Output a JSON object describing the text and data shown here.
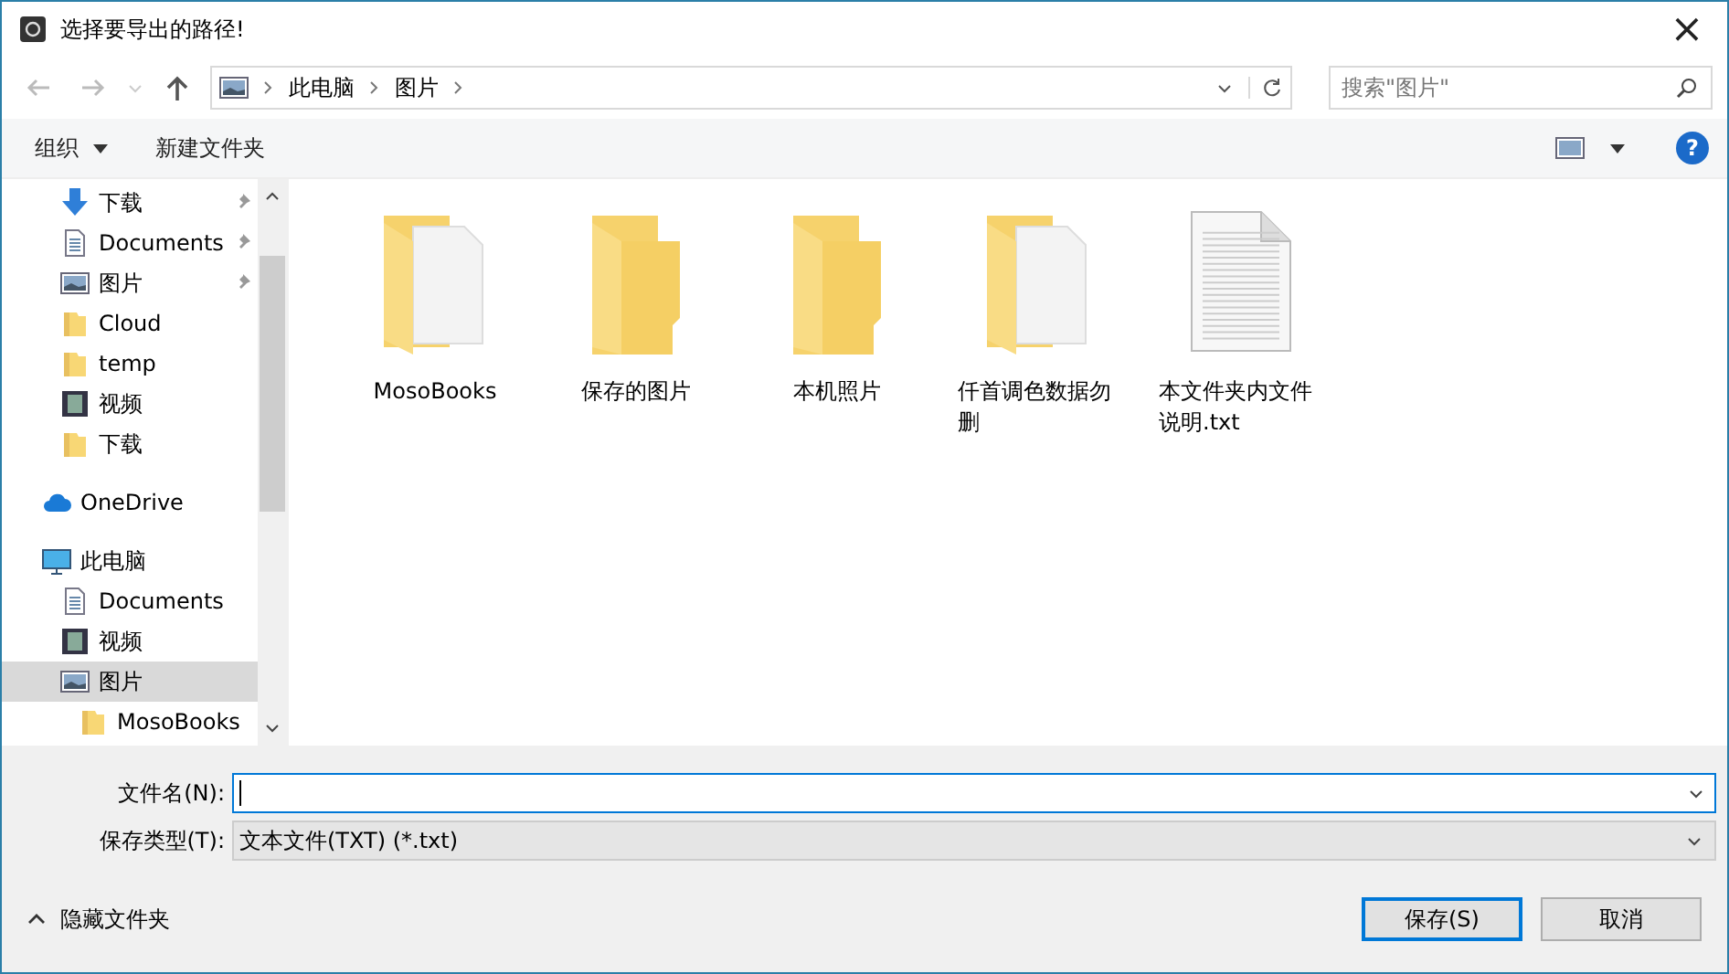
{
  "window": {
    "title": "选择要导出的路径!",
    "close": "×"
  },
  "address": {
    "crumbs": [
      "此电脑",
      "图片"
    ]
  },
  "search": {
    "placeholder": "搜索\"图片\""
  },
  "toolbar": {
    "organize": "组织",
    "new_folder": "新建文件夹",
    "help": "?"
  },
  "sidebar": {
    "items": [
      {
        "label": "下载",
        "kind": "download",
        "pinned": true,
        "selected": false
      },
      {
        "label": "Documents",
        "kind": "document",
        "pinned": true,
        "selected": false
      },
      {
        "label": "图片",
        "kind": "picture",
        "pinned": true,
        "selected": false
      },
      {
        "label": "Cloud",
        "kind": "folder",
        "pinned": false,
        "selected": false
      },
      {
        "label": "temp",
        "kind": "folder",
        "pinned": false,
        "selected": false
      },
      {
        "label": "视频",
        "kind": "video",
        "pinned": false,
        "selected": false
      },
      {
        "label": "下载",
        "kind": "folder",
        "pinned": false,
        "selected": false
      },
      {
        "label": "OneDrive",
        "kind": "cloud",
        "pinned": false,
        "selected": false
      },
      {
        "label": "此电脑",
        "kind": "pc",
        "pinned": false,
        "selected": false,
        "children": [
          {
            "label": "Documents",
            "kind": "document",
            "pinned": false,
            "selected": false
          },
          {
            "label": "视频",
            "kind": "video",
            "pinned": false,
            "selected": false
          },
          {
            "label": "图片",
            "kind": "picture",
            "pinned": false,
            "selected": true,
            "children": [
              {
                "label": "MosoBooks",
                "kind": "folder",
                "pinned": false,
                "selected": false
              }
            ]
          }
        ]
      }
    ]
  },
  "files": [
    {
      "name": "MosoBooks",
      "kind": "folder-docs"
    },
    {
      "name": "保存的图片",
      "kind": "folder"
    },
    {
      "name": "本机照片",
      "kind": "folder"
    },
    {
      "name": "仟首调色数据勿删",
      "kind": "folder-docs"
    },
    {
      "name": "本文件夹内文件说明.txt",
      "kind": "text"
    }
  ],
  "form": {
    "filename_label": "文件名(N):",
    "type_label": "保存类型(T):",
    "type_value": "文本文件(TXT) (*.txt)"
  },
  "footer": {
    "hide_folders": "隐藏文件夹",
    "buttons": [
      {
        "label": "保存(S)",
        "default": true
      },
      {
        "label": "取消",
        "default": false
      }
    ]
  }
}
